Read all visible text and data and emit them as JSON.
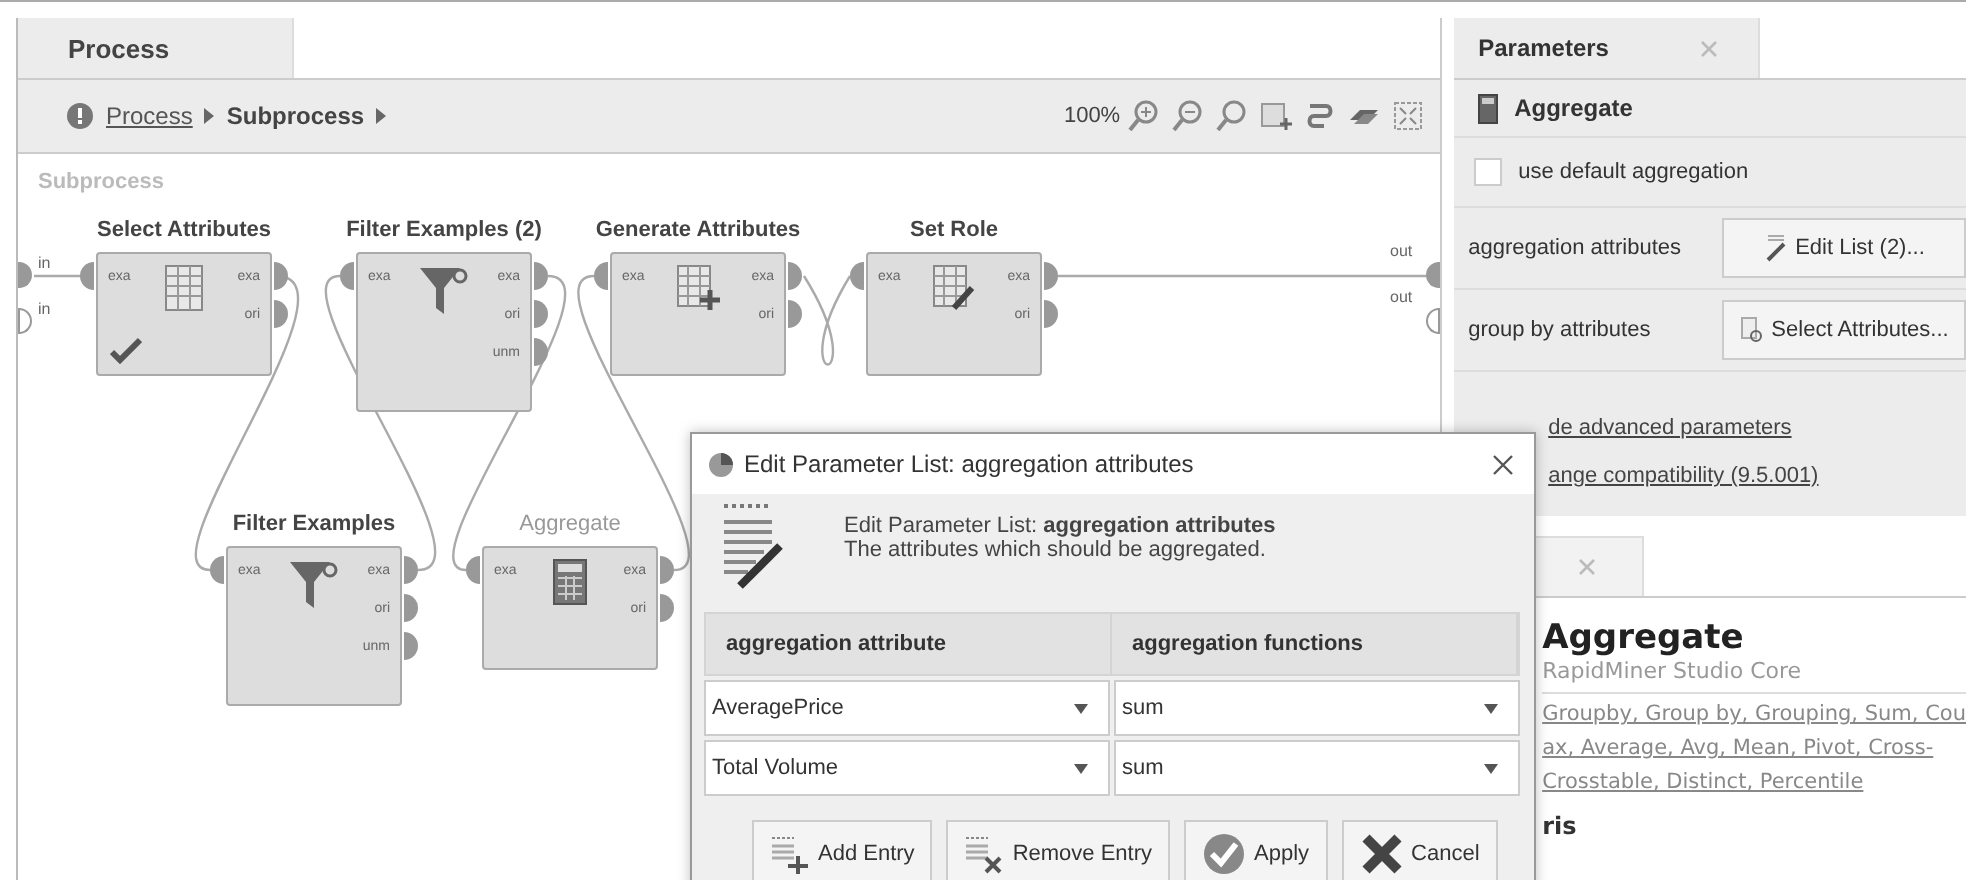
{
  "process_panel": {
    "tab": {
      "label": "Process",
      "selected": true
    },
    "breadcrumb": [
      {
        "label": "Process",
        "kind": "link"
      },
      {
        "label": "Subprocess",
        "kind": "current"
      }
    ],
    "zoom_level": "100%",
    "canvas": {
      "title": "Subprocess",
      "inputs": [
        {
          "label": "in",
          "connected": true
        },
        {
          "label": "in",
          "connected": false
        }
      ],
      "outputs": [
        {
          "label": "out",
          "connected": true
        },
        {
          "label": "out",
          "connected": false
        }
      ],
      "operators": [
        {
          "name": "Select Attributes",
          "kind": "table",
          "inputs": [
            "exa"
          ],
          "outputs": [
            "exa",
            "ori"
          ],
          "checked": true,
          "disabled": false
        },
        {
          "name": "Filter Examples (2)",
          "kind": "filter",
          "inputs": [
            "exa"
          ],
          "outputs": [
            "exa",
            "ori",
            "unm"
          ],
          "checked": false,
          "disabled": false
        },
        {
          "name": "Generate Attributes",
          "kind": "table-add",
          "inputs": [
            "exa"
          ],
          "outputs": [
            "exa",
            "ori"
          ],
          "checked": false,
          "disabled": false
        },
        {
          "name": "Set Role",
          "kind": "table-edit",
          "inputs": [
            "exa"
          ],
          "outputs": [
            "exa",
            "ori"
          ],
          "checked": false,
          "disabled": false
        },
        {
          "name": "Filter Examples",
          "kind": "filter",
          "inputs": [
            "exa"
          ],
          "outputs": [
            "exa",
            "ori",
            "unm"
          ],
          "checked": false,
          "disabled": false
        },
        {
          "name": "Aggregate",
          "kind": "calculator",
          "inputs": [
            "exa"
          ],
          "outputs": [
            "exa",
            "ori"
          ],
          "checked": false,
          "disabled": true
        }
      ]
    }
  },
  "parameters_panel": {
    "tab": {
      "label": "Parameters",
      "selected": true
    },
    "operator": "Aggregate",
    "params": [
      {
        "kind": "checkbox",
        "label": "use default aggregation",
        "checked": false
      },
      {
        "kind": "button",
        "label": "aggregation attributes",
        "button": "Edit List (2)..."
      },
      {
        "kind": "button",
        "label": "group by attributes",
        "button": "Select Attributes..."
      }
    ],
    "links": [
      "de advanced parameters",
      "ange compatibility (9.5.001)"
    ],
    "help": {
      "title": "Aggregate",
      "subtitle": "RapidMiner Studio Core",
      "tags": [
        "Groupby, Group by, Grouping, Sum, Cou",
        "ax, Average, Avg, Mean, Pivot, Cross-",
        "Crosstable, Distinct, Percentile"
      ],
      "section": "ris"
    }
  },
  "dialog": {
    "title": "Edit Parameter List: aggregation attributes",
    "heading": "Edit Parameter List: **aggregation attributes**",
    "description": "The attributes which should be aggregated.",
    "columns": [
      "aggregation attribute",
      "aggregation functions"
    ],
    "rows": [
      [
        "AveragePrice",
        "sum"
      ],
      [
        "Total Volume",
        "sum"
      ]
    ],
    "buttons": [
      {
        "label": "Add Entry",
        "kind": "add"
      },
      {
        "label": "Remove Entry",
        "kind": "remove"
      },
      {
        "label": "Apply",
        "kind": "apply"
      },
      {
        "label": "Cancel",
        "kind": "cancel"
      }
    ]
  }
}
